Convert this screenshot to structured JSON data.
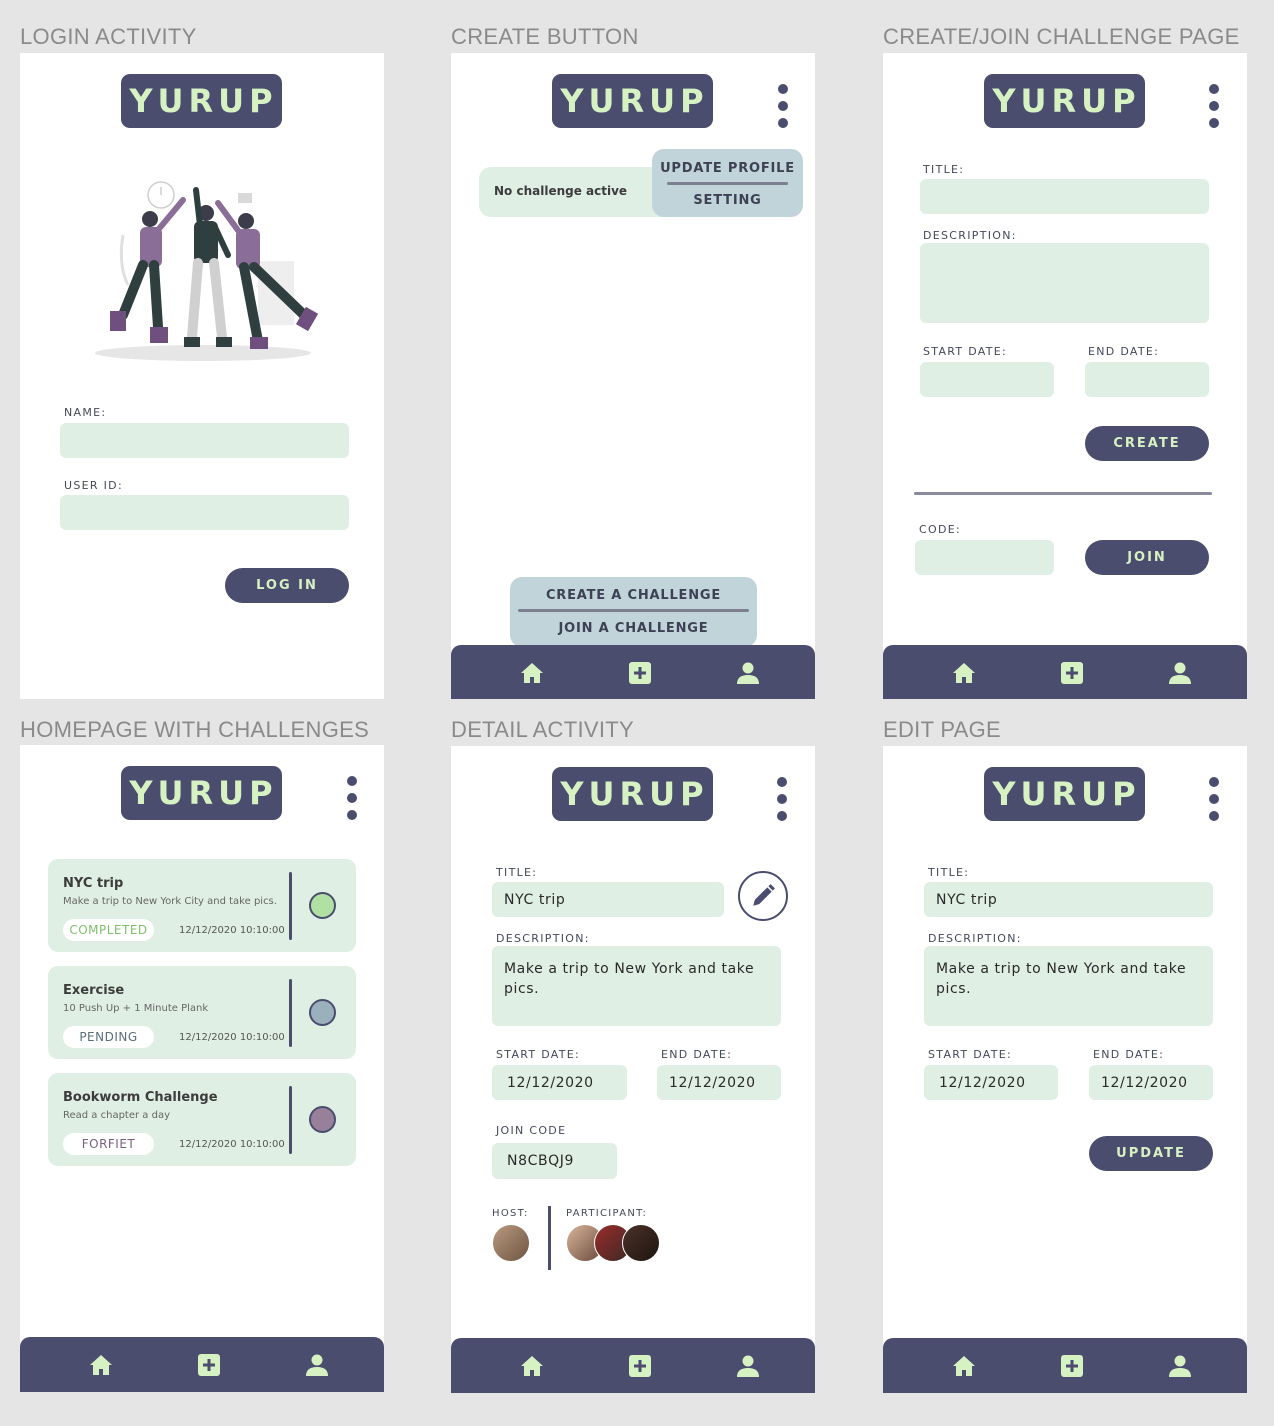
{
  "app": {
    "logo_text": "YURUP"
  },
  "colors": {
    "primary": "#4a4d6e",
    "logo_text": "#d7f2c2",
    "field": "#e0efe3",
    "menu": "#c1d4da",
    "completed": "#b1e0a3",
    "pending": "#9ab0bc",
    "forfeit": "#98809a"
  },
  "sections": {
    "login": "LOGIN ACTIVITY",
    "create_button": "CREATE BUTTON",
    "create_join": "CREATE/JOIN CHALLENGE PAGE",
    "homepage": "HOMEPAGE WITH CHALLENGES",
    "detail": "DETAIL ACTIVITY",
    "edit": "EDIT PAGE"
  },
  "login": {
    "name_label": "NAME:",
    "userid_label": "USER ID:",
    "login_button": "LOG IN"
  },
  "create_button_screen": {
    "status_text": "No challenge active",
    "menu_update_profile": "UPDATE PROFILE",
    "menu_setting": "SETTING",
    "create_challenge": "CREATE A CHALLENGE",
    "join_challenge": "JOIN A CHALLENGE"
  },
  "create_join": {
    "title_label": "TITLE:",
    "description_label": "DESCRIPTION:",
    "start_date_label": "START DATE:",
    "end_date_label": "END DATE:",
    "create_button": "CREATE",
    "code_label": "CODE:",
    "join_button": "JOIN"
  },
  "homepage": {
    "challenges": [
      {
        "title": "NYC trip",
        "description": "Make a trip to New York City and take pics.",
        "status": "COMPLETED",
        "timestamp": "12/12/2020  10:10:00"
      },
      {
        "title": "Exercise",
        "description": "10 Push Up + 1 Minute Plank",
        "status": "PENDING",
        "timestamp": "12/12/2020  10:10:00"
      },
      {
        "title": "Bookworm Challenge",
        "description": "Read a chapter a day",
        "status": "FORFIET",
        "timestamp": "12/12/2020  10:10:00"
      }
    ]
  },
  "detail": {
    "title_label": "TITLE:",
    "title_value": "NYC trip",
    "description_label": "DESCRIPTION:",
    "description_value": "Make a trip to New York and take pics.",
    "start_date_label": "START DATE:",
    "start_date_value": "12/12/2020",
    "end_date_label": "END DATE:",
    "end_date_value": "12/12/2020",
    "join_code_label": "JOIN CODE",
    "join_code_value": "N8CBQJ9",
    "host_label": "HOST:",
    "participant_label": "PARTICIPANT:"
  },
  "edit": {
    "title_label": "TITLE:",
    "title_value": "NYC trip",
    "description_label": "DESCRIPTION:",
    "description_value": "Make a trip to New York and take pics.",
    "start_date_label": "START DATE:",
    "start_date_value": "12/12/2020",
    "end_date_label": "END DATE:",
    "end_date_value": "12/12/2020",
    "update_button": "UPDATE"
  },
  "nav": {
    "icons": [
      "home-icon",
      "add-icon",
      "profile-icon"
    ]
  }
}
